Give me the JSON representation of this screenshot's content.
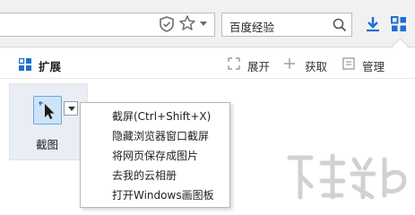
{
  "toolbar": {
    "search_text": "百度经验",
    "icons": [
      "shield-icon",
      "star-icon",
      "search-icon",
      "download-icon",
      "apps-icon"
    ]
  },
  "panel": {
    "title": "扩展",
    "actions": {
      "expand": "展开",
      "get": "获取",
      "manage": "管理"
    }
  },
  "extension": {
    "label": "截图"
  },
  "menu": {
    "items": [
      "截屏(Ctrl+Shift+X)",
      "隐藏浏览器窗口截屏",
      "将网页保存成图片",
      "去我的云相册",
      "打开Windows画图板"
    ]
  },
  "colors": {
    "accent": "#1e6fd0",
    "tile_bg": "#e9eef5",
    "tile_button": "#cfe3f7"
  }
}
